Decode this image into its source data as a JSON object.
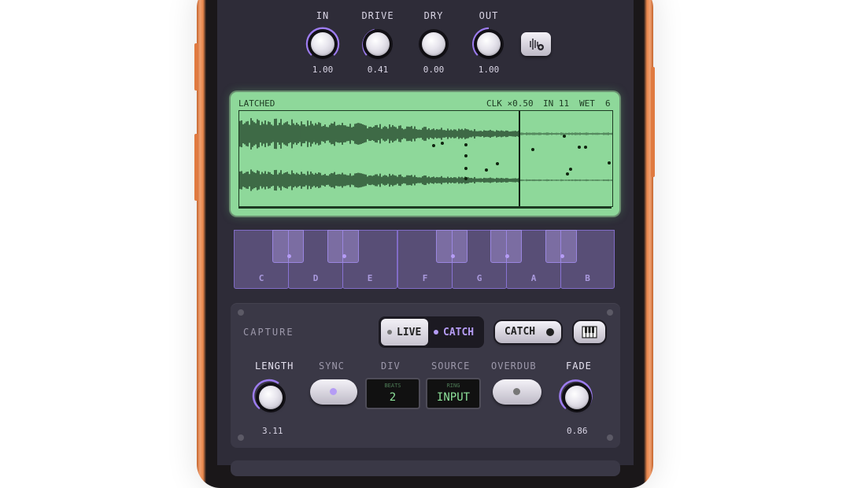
{
  "knobs_top": [
    {
      "label": "IN",
      "value": "1.00"
    },
    {
      "label": "DRIVE",
      "value": "0.41"
    },
    {
      "label": "DRY",
      "value": "0.00"
    },
    {
      "label": "OUT",
      "value": "1.00"
    }
  ],
  "display": {
    "status": "LATCHED",
    "clk": "CLK ×0.50",
    "in": "IN 11",
    "wet": "WET",
    "wet_value": "6"
  },
  "keyboard": {
    "white_keys": [
      "C",
      "D",
      "E",
      "F",
      "G",
      "A",
      "B"
    ]
  },
  "capture": {
    "title": "CAPTURE",
    "live_label": "LIVE",
    "catch_toggle_label": "CATCH",
    "catch_button_label": "CATCH",
    "controls": {
      "length_label": "LENGTH",
      "length_value": "3.11",
      "sync_label": "SYNC",
      "div_label": "DIV",
      "div_small": "BEATS",
      "div_value": "2",
      "source_label": "SOURCE",
      "source_small": "RING",
      "source_value": "INPUT",
      "overdub_label": "OVERDUB",
      "fade_label": "FADE",
      "fade_value": "0.86"
    }
  },
  "colors": {
    "accent": "#9d7cf0",
    "display_bg": "#8ed89a",
    "frame": "#e8864b"
  }
}
